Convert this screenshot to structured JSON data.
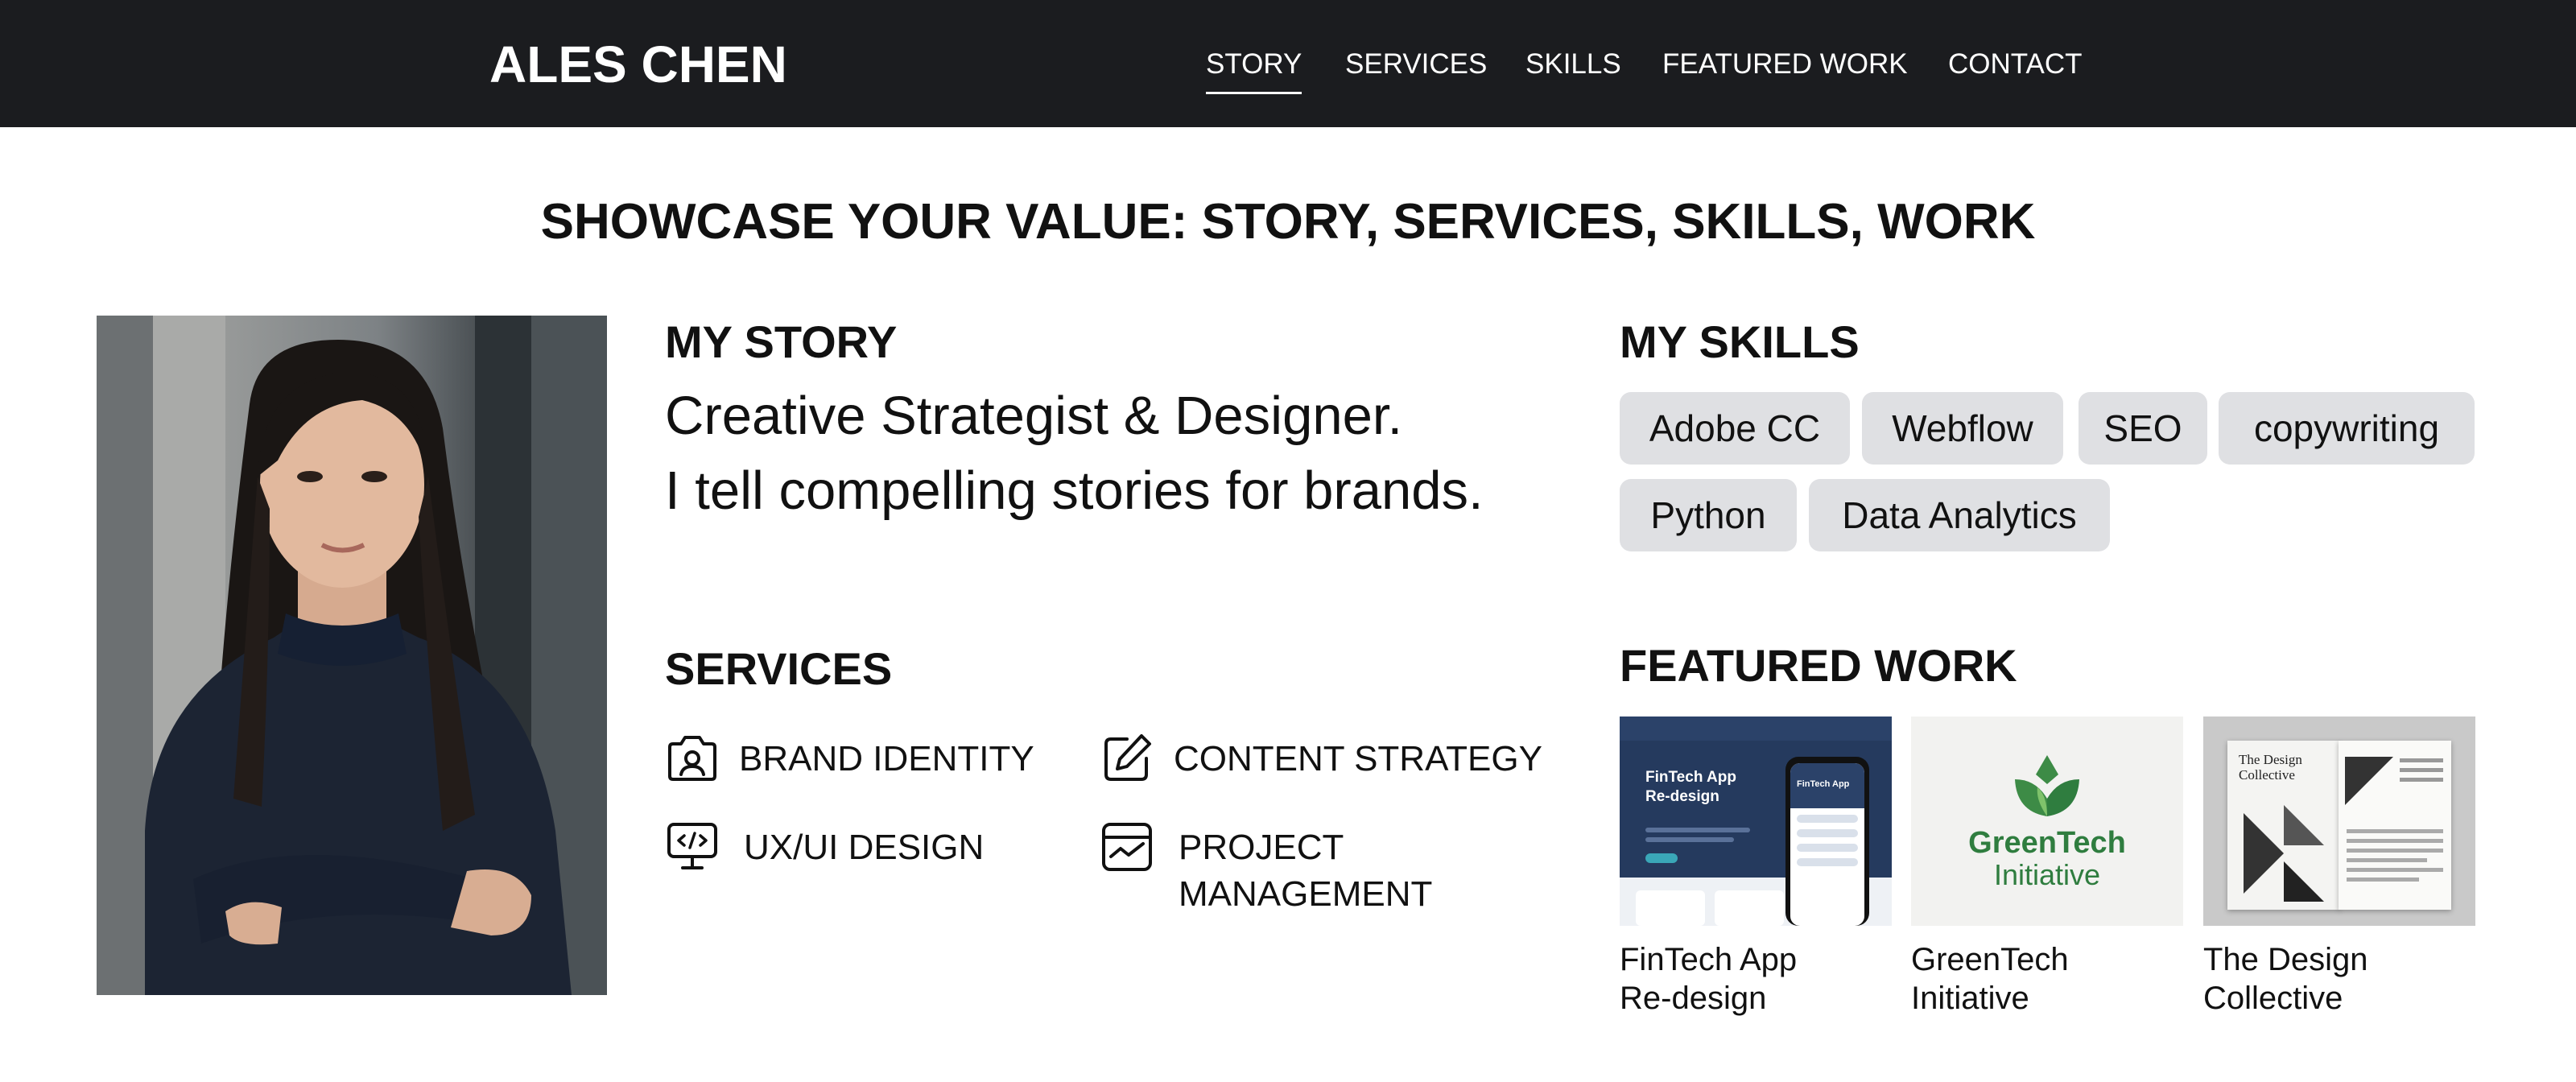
{
  "header": {
    "logo": "ALES CHEN",
    "nav": [
      {
        "label": "STORY",
        "active": true
      },
      {
        "label": "SERVICES",
        "active": false
      },
      {
        "label": "SKILLS",
        "active": false
      },
      {
        "label": "FEATURED WORK",
        "active": false
      },
      {
        "label": "CONTACT",
        "active": false
      }
    ]
  },
  "headline": "SHOWCASE YOUR VALUE: STORY, SERVICES, SKILLS, WORK",
  "story": {
    "title": "MY STORY",
    "line1": "Creative Strategist & Designer.",
    "line2": "I tell compelling stories for brands."
  },
  "services": {
    "title": "SERVICES",
    "items": [
      {
        "label": "BRAND IDENTITY",
        "icon": "brand-identity-icon"
      },
      {
        "label": "CONTENT STRATEGY",
        "icon": "pencil-square-icon"
      },
      {
        "label": "UX/UI DESIGN",
        "icon": "monitor-code-icon"
      },
      {
        "label": "PROJECT\nMANAGEMENT",
        "icon": "chart-card-icon"
      }
    ]
  },
  "skills": {
    "title": "MY SKILLS",
    "items": [
      "Adobe CC",
      "Webflow",
      "SEO",
      "copywriting",
      "Python",
      "Data Analytics"
    ]
  },
  "featured_work": {
    "title": "FEATURED WORK",
    "items": [
      {
        "label": "FinTech App\nRe-design",
        "thumb_title": "FinTech App\nRe-design",
        "phone_title": "FinTech App"
      },
      {
        "label": "GreenTech\nInitiative",
        "logo_line1": "GreenTech",
        "logo_line2": "Initiative"
      },
      {
        "label": "The Design\nCollective",
        "thumb_title": "The Design\nCollective"
      }
    ]
  },
  "colors": {
    "header_bg": "#1b1c1f",
    "chip_bg": "#dfe0e3",
    "green": "#2f7d3f",
    "navy": "#253a5e"
  }
}
